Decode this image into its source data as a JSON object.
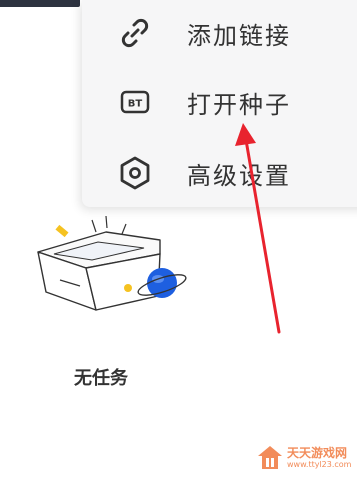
{
  "menu": {
    "items": [
      {
        "label": "添加链接",
        "icon": "link-icon"
      },
      {
        "label": "打开种子",
        "icon": "bt-icon"
      },
      {
        "label": "高级设置",
        "icon": "hexagon-settings-icon"
      }
    ],
    "bt_badge": "BT"
  },
  "empty_state": {
    "text": "无任务",
    "illustration": "empty-box-with-planet"
  },
  "watermark": {
    "title": "天天游戏网",
    "url": "www.ttyl23.com"
  },
  "colors": {
    "menu_bg": "#f6f6f7",
    "text": "#333333",
    "arrow": "#e8232e",
    "accent_blue": "#1e5fe0",
    "accent_yellow": "#f5c221"
  }
}
